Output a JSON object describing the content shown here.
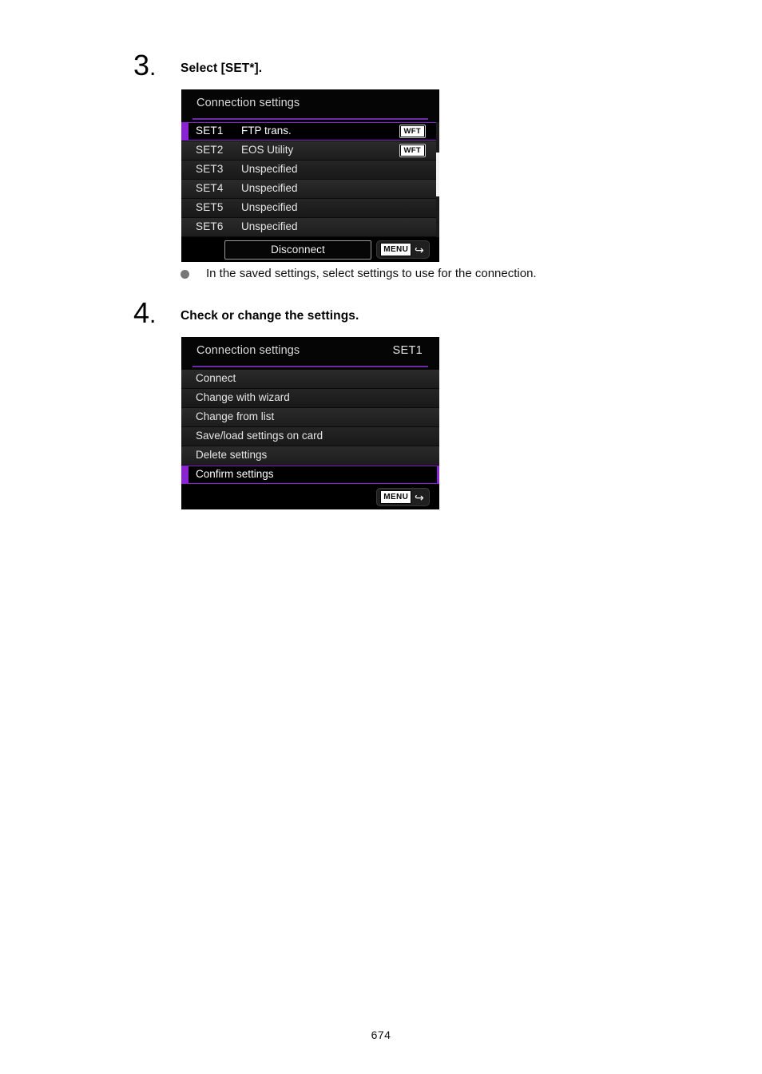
{
  "page": {
    "number": "674"
  },
  "steps": [
    {
      "number": "3",
      "dot": ".",
      "title": "Select [SET*].",
      "screen": {
        "header_title": "Connection settings",
        "header_set": "",
        "rows": [
          {
            "set": "SET1",
            "value": "FTP trans.",
            "badge": "WFT",
            "selected": true
          },
          {
            "set": "SET2",
            "value": "EOS Utility",
            "badge": "WFT",
            "selected": false
          },
          {
            "set": "SET3",
            "value": "Unspecified",
            "badge": "",
            "selected": false
          },
          {
            "set": "SET4",
            "value": "Unspecified",
            "badge": "",
            "selected": false
          },
          {
            "set": "SET5",
            "value": "Unspecified",
            "badge": "",
            "selected": false
          },
          {
            "set": "SET6",
            "value": "Unspecified",
            "badge": "",
            "selected": false
          }
        ],
        "footer_button": "Disconnect",
        "menu_label": "MENU",
        "return_icon": "return-arrow-icon"
      },
      "note": "In the saved settings, select settings to use for the connection."
    },
    {
      "number": "4",
      "dot": ".",
      "title": "Check or change the settings.",
      "screen": {
        "header_title": "Connection settings",
        "header_set": "SET1",
        "rows": [
          {
            "label": "Connect",
            "selected": false
          },
          {
            "label": "Change with wizard",
            "selected": false
          },
          {
            "label": "Change from list",
            "selected": false
          },
          {
            "label": "Save/load settings on card",
            "selected": false
          },
          {
            "label": "Delete settings",
            "selected": false
          },
          {
            "label": "Confirm settings",
            "selected": true
          }
        ],
        "menu_label": "MENU",
        "return_icon": "return-arrow-icon"
      }
    }
  ],
  "colors": {
    "accent_purple": "#8a23d4",
    "rule_purple": "#6f2aa8",
    "screen_black": "#000000",
    "row_gray": "#232323",
    "text_light": "#e6e6e6"
  }
}
